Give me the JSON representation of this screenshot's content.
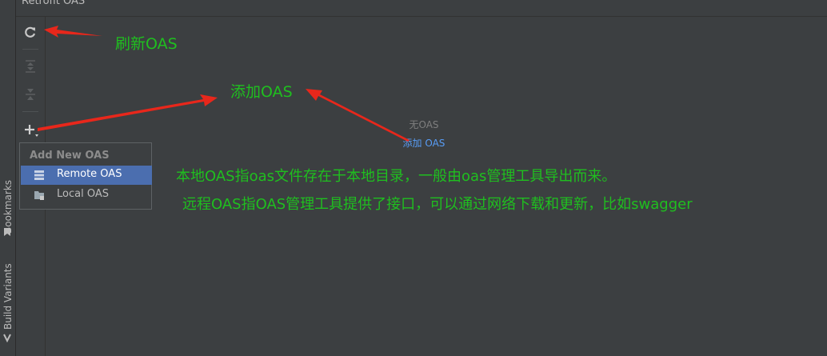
{
  "window": {
    "title": "Retrofit OAS"
  },
  "left_rail": {
    "items": [
      {
        "label": "Bookmarks",
        "icon": "bookmark-icon"
      },
      {
        "label": "Build Variants",
        "icon": "build-variants-icon"
      }
    ]
  },
  "toolbar": {
    "buttons": [
      {
        "icon": "refresh-icon",
        "enabled": true
      },
      {
        "icon": "expand-all-icon",
        "enabled": false
      },
      {
        "icon": "collapse-all-icon",
        "enabled": false
      },
      {
        "icon": "add-icon",
        "enabled": true
      }
    ]
  },
  "empty_state": {
    "title": "无OAS",
    "link": "添加 OAS"
  },
  "popup": {
    "header": "Add New OAS",
    "items": [
      {
        "label": "Remote OAS",
        "icon": "remote-server-icon",
        "selected": true
      },
      {
        "label": "Local OAS",
        "icon": "local-folder-icon",
        "selected": false
      }
    ]
  },
  "annotations": {
    "refresh": "刷新OAS",
    "add": "添加OAS",
    "local_desc": "本地OAS指oas文件存在于本地目录，一般由oas管理工具导出而来。",
    "remote_desc": "远程OAS指OAS管理工具提供了接口，可以通过网络下载和更新，比如swagger"
  },
  "colors": {
    "panel_bg": "#3c3f41",
    "selection": "#4b6eaf",
    "link": "#589df6",
    "annotation_text": "#1fbf1f",
    "arrow": "#e8271b"
  }
}
